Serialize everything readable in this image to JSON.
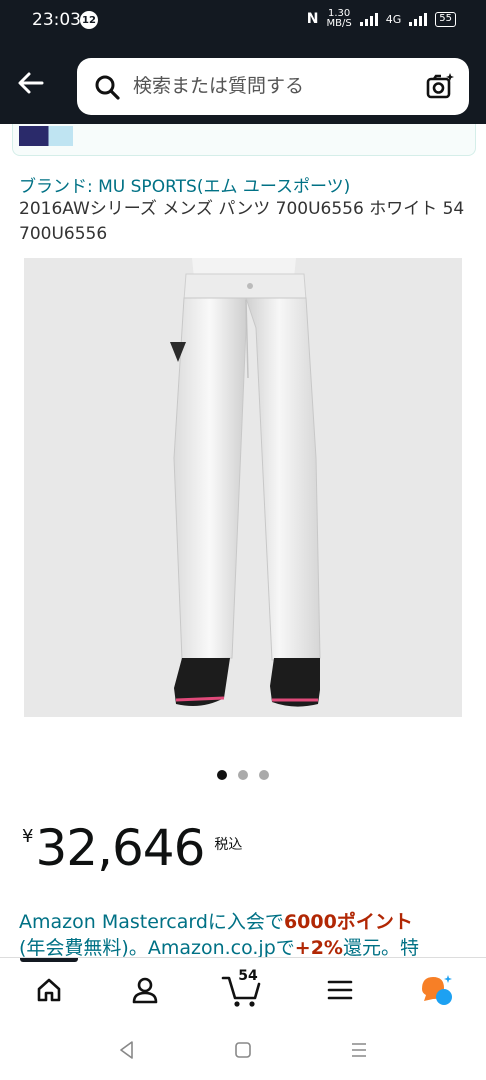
{
  "status_bar": {
    "time": "23:03",
    "notification_count": "12",
    "net_speed_value": "1.30",
    "net_speed_unit": "MB/S",
    "network_label": "4G",
    "battery": "55"
  },
  "search": {
    "placeholder": "検索または質問する"
  },
  "product": {
    "brand_link": "ブランド: MU SPORTS(エム ユースポーツ)",
    "title": "2016AWシリーズ メンズ パンツ 700U6556 ホワイト 54 700U6556",
    "image_alt": "white pants",
    "carousel": {
      "count": 3,
      "active_index": 0
    }
  },
  "price": {
    "currency": "¥",
    "amount": "32,646",
    "tax_label": "税込"
  },
  "promo": {
    "part1": "Amazon Mastercardに入会で",
    "highlight": "6000ポイント",
    "part2": "(年会費無料)。Amazon.co.jpで",
    "highlight2": "+2%",
    "part3": "還元。特"
  },
  "bottom_nav": {
    "items": [
      "home",
      "account",
      "cart",
      "menu",
      "rufus"
    ],
    "cart_count": "54",
    "active_index": 0
  },
  "colors": {
    "header_bg": "#131921",
    "link": "#007185",
    "promo_red": "#b12704",
    "rufus_orange": "#f77f26",
    "rufus_blue": "#1da1f2"
  }
}
